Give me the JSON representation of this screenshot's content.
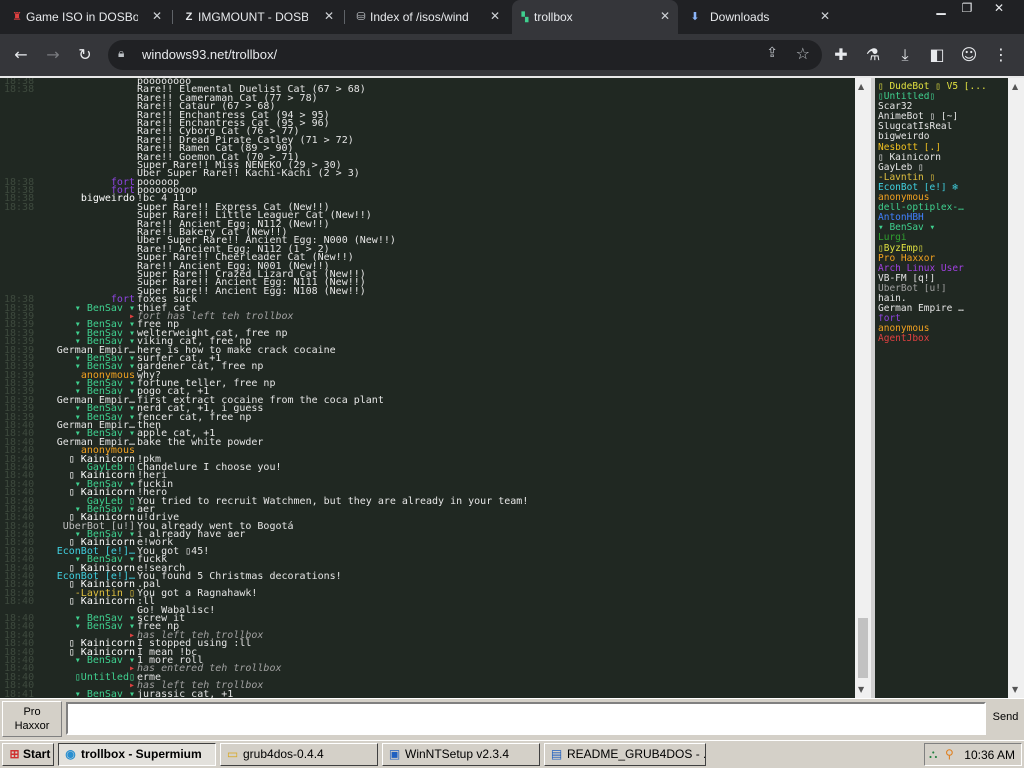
{
  "colors": {
    "chrome_bg": "#202124",
    "chrome_toolbar": "#35363a",
    "chat_bg": "#202822",
    "taskbar_bg": "#d4d0c8"
  },
  "tabs": [
    {
      "title": "Game ISO in DOSBox",
      "icon": "dosbox-icon",
      "active": false
    },
    {
      "title": "IMGMOUNT - DOSBox",
      "icon": "z-icon",
      "active": false
    },
    {
      "title": "Index of /isos/wind",
      "icon": "archive-icon",
      "active": false
    },
    {
      "title": "trollbox",
      "icon": "trollbox-icon",
      "active": true
    },
    {
      "title": "Downloads",
      "icon": "download-icon",
      "active": false
    }
  ],
  "address": {
    "url": "windows93.net/trollbox/"
  },
  "chat_lines": [
    {
      "time": "18:38",
      "nick": "",
      "nick_color": "#8e44e0",
      "msg": "poooooooo"
    },
    {
      "time": "18:38",
      "nick": "",
      "nick_color": "#9b59b6",
      "msg": "Rare!! Elemental Duelist Cat (67 > 68)"
    },
    {
      "time": "",
      "nick": "",
      "nick_color": "#ffffff",
      "msg": "Rare!! Cameraman Cat (77 > 78)"
    },
    {
      "time": "",
      "nick": "",
      "nick_color": "#ffffff",
      "msg": "Rare!! Cataur (67 > 68)"
    },
    {
      "time": "",
      "nick": "",
      "nick_color": "#ffffff",
      "msg": "Rare!! Enchantress Cat (94 > 95)"
    },
    {
      "time": "",
      "nick": "",
      "nick_color": "#ffffff",
      "msg": "Rare!! Enchantress Cat (95 > 96)"
    },
    {
      "time": "",
      "nick": "",
      "nick_color": "#ffffff",
      "msg": "Rare!! Cyborg Cat (76 > 77)"
    },
    {
      "time": "",
      "nick": "",
      "nick_color": "#ffffff",
      "msg": "Rare!! Dread Pirate Catley (71 > 72)"
    },
    {
      "time": "",
      "nick": "",
      "nick_color": "#ffffff",
      "msg": "Rare!! Ramen Cat (89 > 90)"
    },
    {
      "time": "",
      "nick": "",
      "nick_color": "#ffffff",
      "msg": "Rare!! Goemon Cat (70 > 71)"
    },
    {
      "time": "",
      "nick": "",
      "nick_color": "#ffffff",
      "msg": "Super Rare!! Miss NENEKO (29 > 30)"
    },
    {
      "time": "",
      "nick": "",
      "nick_color": "#ffffff",
      "msg": "Uber Super Rare!! Kachi-Kachi (2 > 3)"
    },
    {
      "time": "18:38",
      "nick": "fort",
      "nick_color": "#8e44e0",
      "msg": "pooooop"
    },
    {
      "time": "18:38",
      "nick": "fort",
      "nick_color": "#8e44e0",
      "msg": "poooooooop"
    },
    {
      "time": "18:38",
      "nick": "bigweirdo",
      "nick_color": "#ffffff",
      "msg": "!bc 4 11"
    },
    {
      "time": "18:38",
      "nick": "",
      "nick_color": "#9b59b6",
      "msg": "Super Rare!! Express Cat (New!!)"
    },
    {
      "time": "",
      "nick": "",
      "nick_color": "#ffffff",
      "msg": "Super Rare!! Little Leaguer Cat (New!!)"
    },
    {
      "time": "",
      "nick": "",
      "nick_color": "#ffffff",
      "msg": "Rare!! Ancient Egg: N112 (New!!)"
    },
    {
      "time": "",
      "nick": "",
      "nick_color": "#ffffff",
      "msg": "Rare!! Bakery Cat (New!!)"
    },
    {
      "time": "",
      "nick": "",
      "nick_color": "#ffffff",
      "msg": "Uber Super Rare!! Ancient Egg: N000 (New!!)"
    },
    {
      "time": "",
      "nick": "",
      "nick_color": "#ffffff",
      "msg": "Rare!! Ancient Egg: N112 (1 > 2)"
    },
    {
      "time": "",
      "nick": "",
      "nick_color": "#ffffff",
      "msg": "Super Rare!! Cheerleader Cat (New!!)"
    },
    {
      "time": "",
      "nick": "",
      "nick_color": "#ffffff",
      "msg": "Rare!! Ancient Egg: N001 (New!!)"
    },
    {
      "time": "",
      "nick": "",
      "nick_color": "#ffffff",
      "msg": "Super Rare!! Crazed Lizard Cat (New!!)"
    },
    {
      "time": "",
      "nick": "",
      "nick_color": "#ffffff",
      "msg": "Super Rare!! Ancient Egg: N111 (New!!)"
    },
    {
      "time": "",
      "nick": "",
      "nick_color": "#ffffff",
      "msg": "Super Rare!! Ancient Egg: N108 (New!!)"
    },
    {
      "time": "18:38",
      "nick": "fort",
      "nick_color": "#8e44e0",
      "msg": "foxes suck"
    },
    {
      "time": "18:38",
      "nick": "▾ BenSav ▾",
      "nick_color": "#3fd08f",
      "msg": "thief cat"
    },
    {
      "time": "18:39",
      "nick": "▸",
      "nick_color": "#e04040",
      "msg": "fort has left teh trollbox",
      "system": true
    },
    {
      "time": "18:39",
      "nick": "▾ BenSav ▾",
      "nick_color": "#3fd08f",
      "msg": "free np"
    },
    {
      "time": "18:39",
      "nick": "▾ BenSav ▾",
      "nick_color": "#3fd08f",
      "msg": "welterweight cat, free np"
    },
    {
      "time": "18:39",
      "nick": "▾ BenSav ▾",
      "nick_color": "#3fd08f",
      "msg": "viking cat, free np"
    },
    {
      "time": "18:39",
      "nick": "German Empir…",
      "nick_color": "#e6e6e6",
      "msg": "here is how to make crack cocaine"
    },
    {
      "time": "18:39",
      "nick": "▾ BenSav ▾",
      "nick_color": "#3fd08f",
      "msg": "surfer cat, +1"
    },
    {
      "time": "18:39",
      "nick": "▾ BenSav ▾",
      "nick_color": "#3fd08f",
      "msg": "gardener cat, free np"
    },
    {
      "time": "18:39",
      "nick": "anonymous",
      "nick_color": "#f0a020",
      "msg": "why?"
    },
    {
      "time": "18:39",
      "nick": "▾ BenSav ▾",
      "nick_color": "#3fd08f",
      "msg": "fortune teller, free np"
    },
    {
      "time": "18:39",
      "nick": "▾ BenSav ▾",
      "nick_color": "#3fd08f",
      "msg": "pogo cat, +1"
    },
    {
      "time": "18:39",
      "nick": "German Empir…",
      "nick_color": "#e6e6e6",
      "msg": "first extract cocaine from the coca plant"
    },
    {
      "time": "18:39",
      "nick": "▾ BenSav ▾",
      "nick_color": "#3fd08f",
      "msg": "nerd cat, +1, i guess"
    },
    {
      "time": "18:39",
      "nick": "▾ BenSav ▾",
      "nick_color": "#3fd08f",
      "msg": "fencer cat, free np"
    },
    {
      "time": "18:40",
      "nick": "German Empir…",
      "nick_color": "#e6e6e6",
      "msg": "then"
    },
    {
      "time": "18:40",
      "nick": "▾ BenSav ▾",
      "nick_color": "#3fd08f",
      "msg": "apple cat, +1"
    },
    {
      "time": "18:40",
      "nick": "German Empir…",
      "nick_color": "#e6e6e6",
      "msg": "bake the white powder"
    },
    {
      "time": "18:40",
      "nick": "anonymous",
      "nick_color": "#f0a020",
      "msg": ""
    },
    {
      "time": "18:40",
      "nick": "▯ Kainicorn",
      "nick_color": "#ffffff",
      "msg": "!pkm"
    },
    {
      "time": "18:40",
      "nick": "GayLeb ▯",
      "nick_color": "#3fd08f",
      "msg": "Chandelure I choose you!"
    },
    {
      "time": "18:40",
      "nick": "▯ Kainicorn",
      "nick_color": "#ffffff",
      "msg": "!heri"
    },
    {
      "time": "18:40",
      "nick": "▾ BenSav ▾",
      "nick_color": "#3fd08f",
      "msg": "fuckin"
    },
    {
      "time": "18:40",
      "nick": "▯ Kainicorn",
      "nick_color": "#ffffff",
      "msg": "!hero"
    },
    {
      "time": "18:40",
      "nick": "GayLeb ▯",
      "nick_color": "#3fd08f",
      "msg": "You tried to recruit Watchmen, but they are already in your team!"
    },
    {
      "time": "18:40",
      "nick": "▾ BenSav ▾",
      "nick_color": "#3fd08f",
      "msg": "aer"
    },
    {
      "time": "18:40",
      "nick": "▯ Kainicorn",
      "nick_color": "#ffffff",
      "msg": "u!drive"
    },
    {
      "time": "18:40",
      "nick": "UberBot [u!]",
      "nick_color": "#c0c0c0",
      "msg": "You already went to Bogotá"
    },
    {
      "time": "18:40",
      "nick": "▾ BenSav ▾",
      "nick_color": "#3fd08f",
      "msg": "i already have aer"
    },
    {
      "time": "18:40",
      "nick": "▯ Kainicorn",
      "nick_color": "#ffffff",
      "msg": "e!work"
    },
    {
      "time": "18:40",
      "nick": "EconBot [e!]…",
      "nick_color": "#40d0e0",
      "msg": "You got ▯45!"
    },
    {
      "time": "18:40",
      "nick": "▾ BenSav ▾",
      "nick_color": "#3fd08f",
      "msg": "fuckk"
    },
    {
      "time": "18:40",
      "nick": "▯ Kainicorn",
      "nick_color": "#ffffff",
      "msg": "e!search"
    },
    {
      "time": "18:40",
      "nick": "EconBot [e!]…",
      "nick_color": "#40d0e0",
      "msg": "You found 5 Christmas decorations!"
    },
    {
      "time": "18:40",
      "nick": "▯ Kainicorn",
      "nick_color": "#ffffff",
      "msg": ".pal"
    },
    {
      "time": "18:40",
      "nick": "-Lavntin ▯",
      "nick_color": "#e0c040",
      "msg": "You got a Ragnahawk!"
    },
    {
      "time": "18:40",
      "nick": "▯ Kainicorn",
      "nick_color": "#ffffff",
      "msg": ":ll"
    },
    {
      "time": "",
      "nick": "",
      "nick_color": "#ffffff",
      "msg": "Go! Wabalisc!"
    },
    {
      "time": "18:40",
      "nick": "▾ BenSav ▾",
      "nick_color": "#3fd08f",
      "msg": "screw it"
    },
    {
      "time": "18:40",
      "nick": "▾ BenSav ▾",
      "nick_color": "#3fd08f",
      "msg": "free np"
    },
    {
      "time": "18:40",
      "nick": "▸",
      "nick_color": "#e04040",
      "msg": "has left teh trollbox",
      "system": true
    },
    {
      "time": "18:40",
      "nick": "▯ Kainicorn",
      "nick_color": "#ffffff",
      "msg": "I stopped using :ll"
    },
    {
      "time": "18:40",
      "nick": "▯ Kainicorn",
      "nick_color": "#ffffff",
      "msg": "I mean !bc"
    },
    {
      "time": "18:40",
      "nick": "▾ BenSav ▾",
      "nick_color": "#3fd08f",
      "msg": "1 more roll"
    },
    {
      "time": "18:40",
      "nick": "▸",
      "nick_color": "#e04040",
      "msg": "has entered teh trollbox",
      "system": true
    },
    {
      "time": "18:40",
      "nick": "▯Untitled▯",
      "nick_color": "#3fd08f",
      "msg": "erme"
    },
    {
      "time": "18:40",
      "nick": "▸",
      "nick_color": "#e04040",
      "msg": "has left teh trollbox",
      "system": true
    },
    {
      "time": "18:41",
      "nick": "▾ BenSav ▾",
      "nick_color": "#3fd08f",
      "msg": "jurassic cat, +1"
    }
  ],
  "users": [
    {
      "name": "▯ DudeBot ▯ V5 [...",
      "color": "#e0e040"
    },
    {
      "name": "▯Untitled▯",
      "color": "#3fd08f"
    },
    {
      "name": "Scar32",
      "color": "#e6e6e6"
    },
    {
      "name": "AnimeBot ▯ [~]",
      "color": "#e6e6e6"
    },
    {
      "name": "SlugcatIsReal",
      "color": "#e6e6e6"
    },
    {
      "name": "bigweirdo",
      "color": "#e6e6e6"
    },
    {
      "name": "Nesbott [.]",
      "color": "#f0c020"
    },
    {
      "name": "▯ Kainicorn",
      "color": "#e6e6e6"
    },
    {
      "name": "GayLeb ▯",
      "color": "#e6e6e6"
    },
    {
      "name": "-Lavntin ▯",
      "color": "#e0c040"
    },
    {
      "name": "EconBot [e!] ❄",
      "color": "#40d0e0"
    },
    {
      "name": "anonymous",
      "color": "#f0a020"
    },
    {
      "name": "dell-optiplex-…",
      "color": "#3fd08f"
    },
    {
      "name": "AntonHBH",
      "color": "#4080ff"
    },
    {
      "name": "▾ BenSav ▾",
      "color": "#3fd08f"
    },
    {
      "name": "Lurgi",
      "color": "#30a030"
    },
    {
      "name": "▯ByzEmp▯",
      "color": "#e0e040"
    },
    {
      "name": "Pro Haxxor",
      "color": "#f0a020"
    },
    {
      "name": "Arch Linux User",
      "color": "#a040e0"
    },
    {
      "name": "VB-FM [q!]",
      "color": "#e6e6e6"
    },
    {
      "name": "UberBot [u!]",
      "color": "#a0a0a0"
    },
    {
      "name": "hain.",
      "color": "#e6e6e6"
    },
    {
      "name": "German Empire …",
      "color": "#e6e6e6"
    },
    {
      "name": "fort",
      "color": "#8e44e0"
    },
    {
      "name": "anonymous",
      "color": "#f0a020"
    },
    {
      "name": "AgentJbox",
      "color": "#e04040"
    }
  ],
  "input": {
    "nick_line1": "Pro",
    "nick_line2": "Haxxor",
    "value": "",
    "send_label": "Send"
  },
  "taskbar": {
    "start_label": "Start",
    "windows": [
      {
        "label": "trollbox - Supermium",
        "icon": "chrome-icon",
        "active": true
      },
      {
        "label": "grub4dos-0.4.4",
        "icon": "folder-icon",
        "active": false
      },
      {
        "label": "WinNTSetup v2.3.4",
        "icon": "setup-icon",
        "active": false
      },
      {
        "label": "README_GRUB4DOS - ...",
        "icon": "notepad-icon",
        "active": false
      }
    ],
    "clock": "10:36 AM"
  }
}
